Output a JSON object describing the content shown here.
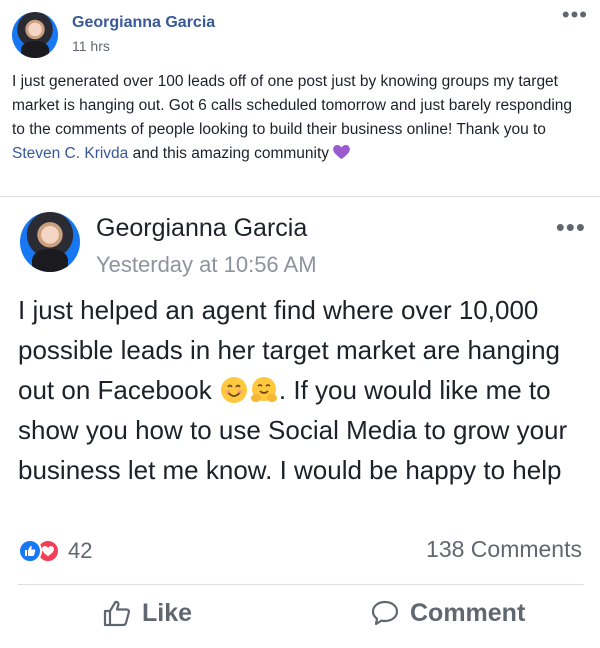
{
  "outer_post": {
    "author": "Georgianna Garcia",
    "time": "11 hrs",
    "text_before_link": "I just generated over 100 leads off of one post just by knowing groups my target market is hanging out. Got 6 calls scheduled tomorrow and just barely responding to the comments of people looking to build their business online! Thank you to ",
    "link_text": "Steven C. Krivda",
    "text_after_link": " and this amazing community ",
    "more_icon": "more-dots-icon",
    "emoji_icon": "purple-heart-icon"
  },
  "shared_post": {
    "author": "Georgianna Garcia",
    "time": "Yesterday at 10:56 AM",
    "text_part1": "I just helped an agent find where over 10,000 possible leads in her target market are hanging out on Facebook ",
    "text_part2": ". If you would like me to show you how to use Social Media to grow your business let me know. I would be happy to help",
    "emoji_icons": [
      "smiling-face-icon",
      "hugging-face-icon"
    ],
    "reactions_count": "42",
    "comments_count": "138 Comments",
    "like_label": "Like",
    "comment_label": "Comment"
  },
  "colors": {
    "link": "#385898",
    "like_blue": "#1877f2",
    "love_red": "#f33e58"
  }
}
